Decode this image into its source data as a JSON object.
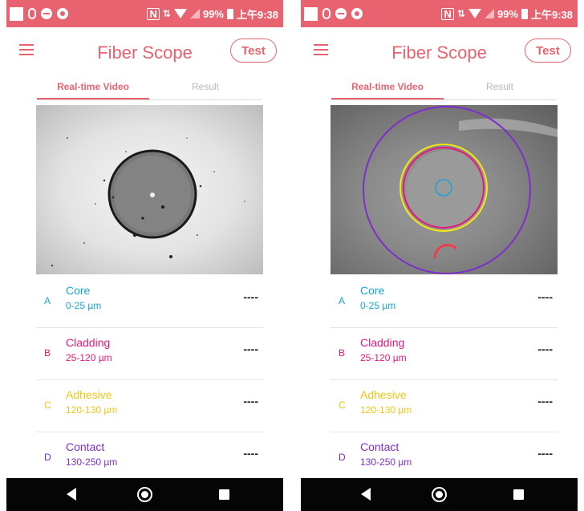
{
  "status_bar": {
    "nfc": "N",
    "arrows": "⇅",
    "battery_percent": "99%",
    "time": "上午9:38"
  },
  "app": {
    "title": "Fiber Scope",
    "test_button_label": "Test",
    "accent_color": "#e8636f"
  },
  "tabs": [
    {
      "label": "Real-time Video",
      "active": true
    },
    {
      "label": "Result",
      "active": false
    }
  ],
  "zones": [
    {
      "letter": "A",
      "name": "Core",
      "range": "0-25 µm",
      "value": "----",
      "color": "#1aa3d9"
    },
    {
      "letter": "B",
      "name": "Cladding",
      "range": "25-120 µm",
      "value": "----",
      "color": "#e5187a"
    },
    {
      "letter": "C",
      "name": "Adhesive",
      "range": "120-130 µm",
      "value": "----",
      "color": "#f2c518"
    },
    {
      "letter": "D",
      "name": "Contact",
      "range": "130-250 µm",
      "value": "----",
      "color": "#7d2fc8"
    }
  ],
  "screens": [
    {
      "id": "left",
      "description_view": "raw fiber end-face video"
    },
    {
      "id": "right",
      "description_view": "end-face with zone overlay circles"
    }
  ],
  "nav": {
    "back_icon": "back-triangle-icon",
    "home_icon": "home-circle-icon",
    "recent_icon": "recent-square-icon"
  }
}
